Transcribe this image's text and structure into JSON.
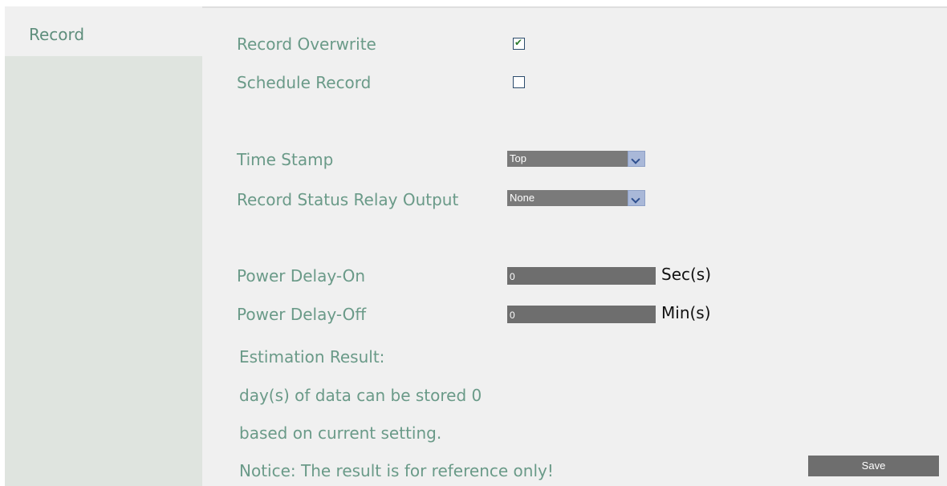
{
  "sidebar": {
    "active_tab": "Record"
  },
  "form": {
    "record_overwrite_label": "Record Overwrite",
    "record_overwrite_checked": true,
    "schedule_record_label": "Schedule Record",
    "schedule_record_checked": false,
    "time_stamp_label": "Time Stamp",
    "time_stamp_value": "Top",
    "relay_output_label": "Record Status Relay Output",
    "relay_output_value": "None",
    "power_delay_on_label": "Power Delay-On",
    "power_delay_on_value": "0",
    "power_delay_on_unit": "Sec(s)",
    "power_delay_off_label": "Power Delay-Off",
    "power_delay_off_value": "0",
    "power_delay_off_unit": "Min(s)"
  },
  "estimation": {
    "title": "Estimation Result:",
    "line1": "day(s) of data can be stored 0",
    "line2": "based on current setting.",
    "notice": "Notice: The result is for reference only!"
  },
  "actions": {
    "save_label": "Save"
  },
  "colors": {
    "label_green": "#6a9a88",
    "sidebar_bg": "#dfe4df",
    "content_bg": "#f0f0f0"
  },
  "icons": {
    "checkbox_checked": "check-icon",
    "dropdown_arrow": "chevron-down-icon"
  }
}
